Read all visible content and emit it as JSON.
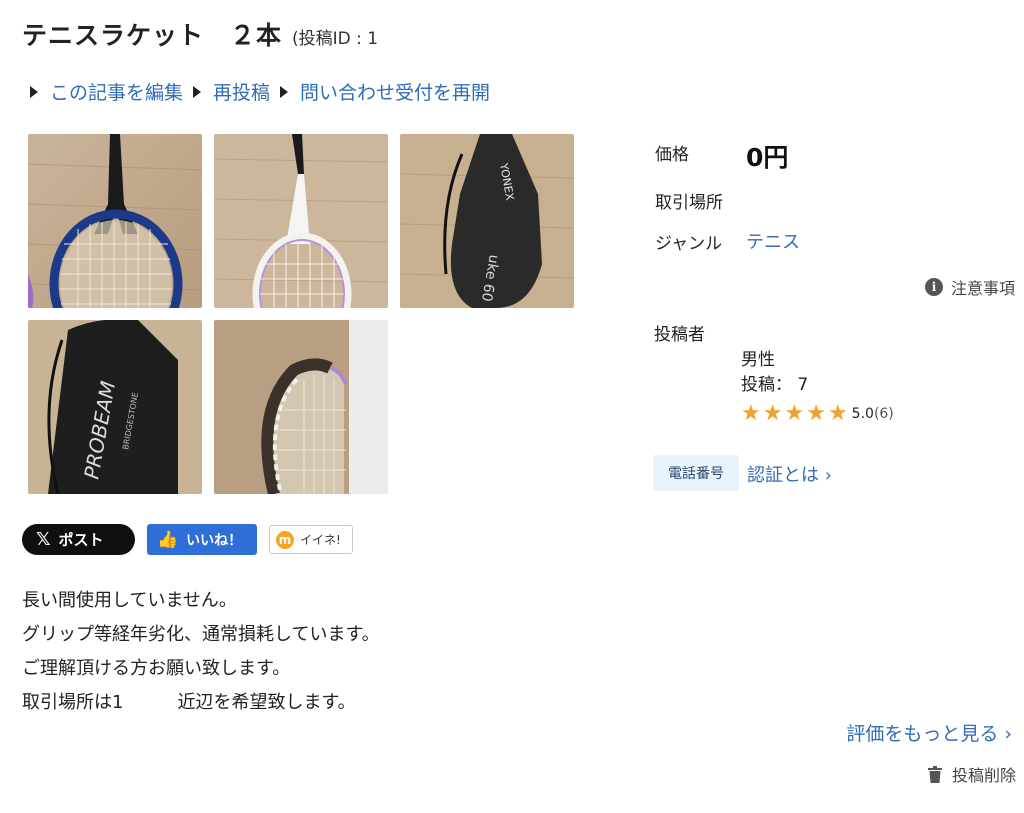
{
  "post": {
    "title": "テニスラケット　２本",
    "post_id_label": "(投稿ID : 1"
  },
  "actions": [
    {
      "label": "この記事を編集"
    },
    {
      "label": "再投稿"
    },
    {
      "label": "問い合わせ受付を再開"
    }
  ],
  "details": {
    "price_label": "価格",
    "price_value": "0円",
    "location_label": "取引場所",
    "location_value": "",
    "genre_label": "ジャンル",
    "genre_value": "テニス",
    "notice_label": "注意事項"
  },
  "poster": {
    "label": "投稿者",
    "gender": "男性",
    "posts_text": "投稿：  7",
    "stars": 5,
    "rating": "5.0",
    "rating_count": "(6)"
  },
  "verification": {
    "badge": "電話番号",
    "link": "認証とは ›"
  },
  "share": {
    "x_label": "ポスト",
    "x_logo": "𝕏",
    "like_label": "いいね！",
    "iine_label": "イイネ!",
    "iine_logo": "m"
  },
  "description": [
    "長い間使用していません。",
    "グリップ等経年劣化、通常損耗しています。",
    "ご理解頂ける方お願い致します。",
    "取引場所は1　　　近辺を希望致します。"
  ],
  "footer": {
    "more_reviews": "評価をもっと見る ›",
    "delete_label": "投稿削除"
  },
  "colors": {
    "link": "#2f6db5",
    "star": "#f0a22e",
    "like_button": "#2d6fd6",
    "x_button": "#0f0f0f",
    "badge_bg": "#e8f2fb"
  }
}
